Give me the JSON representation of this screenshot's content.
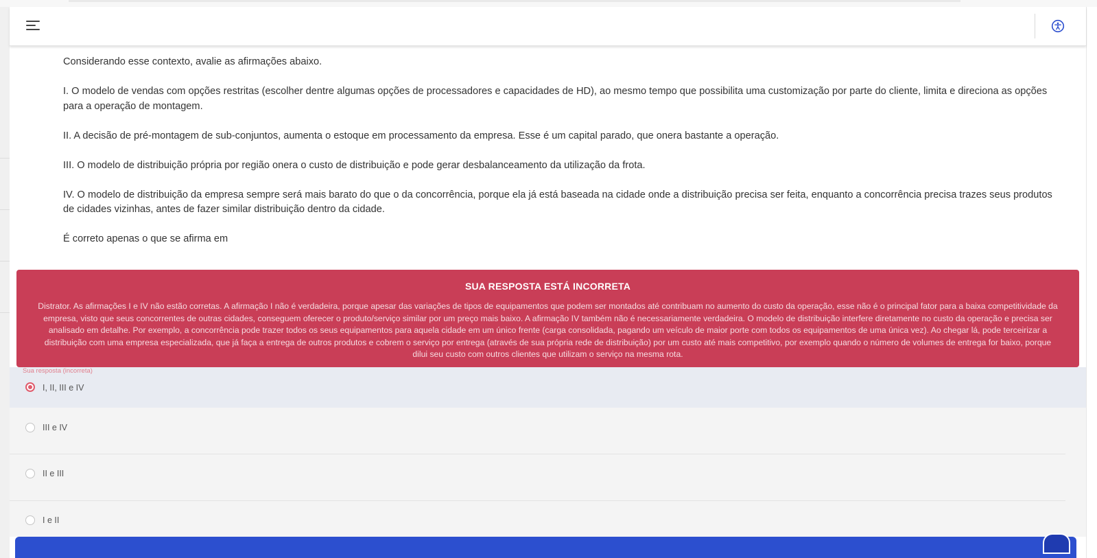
{
  "header": {
    "menu_icon": "hamburger-menu-icon",
    "accessibility_icon": "accessibility-icon",
    "accent_color": "#2c4fcf"
  },
  "question": {
    "paragraphs": [
      "Considerando esse contexto, avalie as afirmações abaixo.",
      "I. O modelo de vendas com opções restritas (escolher dentre algumas opções de processadores e capacidades de HD), ao mesmo tempo que possibilita uma customização por parte do cliente, limita e direciona as opções para a operação de montagem.",
      "II. A decisão de pré-montagem de sub-conjuntos, aumenta o estoque em processamento da empresa. Esse é um capital parado, que onera bastante a operação.",
      "III. O modelo de distribuição própria por região onera o custo de distribuição e pode gerar desbalanceamento da utilização da frota.",
      "IV. O modelo de distribuição da empresa sempre será mais barato do que o da concorrência, porque ela já está baseada na cidade onde a distribuição precisa ser feita, enquanto a concorrência precisa trazes seus produtos de cidades vizinhas, antes de fazer similar distribuição dentro da cidade.",
      "É correto apenas o que se afirma em"
    ]
  },
  "feedback": {
    "title": "SUA RESPOSTA ESTÁ INCORRETA",
    "body": "Distrator. As afirmações I e IV não estão corretas. A afirmação I não é verdadeira, porque apesar das variações de tipos de equipamentos que podem ser montados até contribuam no aumento do custo da operação, esse não é o principal fator para a baixa competitividade da empresa, visto que seus concorrentes de outras cidades, conseguem oferecer o produto/serviço similar por um preço mais baixo. A afirmação IV também não é necessariamente verdadeira. O modelo de distribuição interfere diretamente no custo da operação e precisa ser analisado em detalhe. Por exemplo, a concorrência pode trazer todos os seus equipamentos para aquela cidade em um único frente (carga consolidada, pagando um veículo de maior porte com todos os equipamentos de uma única vez). Ao chegar lá, pode terceirizar a distribuição com uma empresa especializada, que já faça a entrega de outros produtos e cobrem o serviço por entrega (através de sua própria rede de distribuição) por um custo até mais competitivo, por exemplo quando o número de volumes de entrega for baixo, porque dilui seu custo com outros clientes que utilizam o serviço na mesma rota.",
    "color": "#c93e57"
  },
  "options": {
    "your_answer_label": "Sua resposta (incorreta)",
    "items": [
      {
        "label": "I, II, III e IV",
        "selected": true
      },
      {
        "label": "III e IV",
        "selected": false
      },
      {
        "label": "II e III",
        "selected": false
      },
      {
        "label": "I e II",
        "selected": false
      }
    ]
  }
}
